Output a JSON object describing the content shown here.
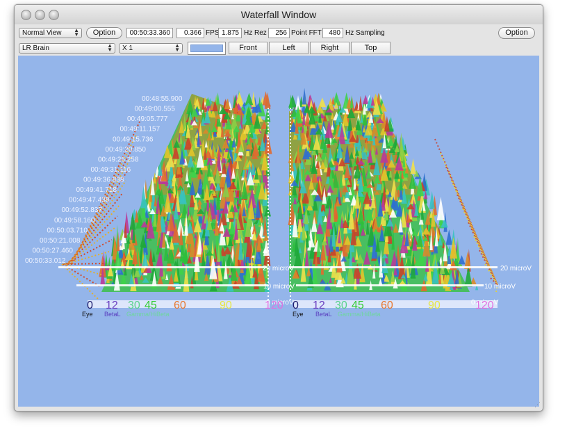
{
  "window": {
    "title": "Waterfall Window"
  },
  "toolbar": {
    "view_mode": "Normal View",
    "option_label": "Option",
    "option_right_label": "Option",
    "time_value": "00:50:33.360",
    "fps_value": "0.366",
    "fps_label": "FPS",
    "hz_rez_value": "1.875",
    "hz_rez_label": "Hz Rez",
    "fft_value": "256",
    "fft_label": "Point FFT",
    "sampling_value": "480",
    "sampling_label": "Hz Sampling",
    "channel": "LR Brain",
    "scale": "X 1",
    "bg_color": "#94b5ea",
    "front_label": "Front",
    "left_label": "Left",
    "right_label": "Right",
    "top_label": "Top"
  },
  "plot": {
    "background": "#94b5ea",
    "timestamps": [
      "00:48:55.900",
      "00:49:00.555",
      "00:49:05.777",
      "00:49:11.157",
      "00:49:15.736",
      "00:49:20.850",
      "00:49:26.258",
      "00:49:31.116",
      "00:49:36.838",
      "00:49:41.718",
      "00:49:47.438",
      "00:49:52.837",
      "00:49:58.160",
      "00:50:03.710",
      "00:50:21.008",
      "00:50:27.460",
      "00:50:33.012"
    ],
    "amplitude_labels": [
      "20 microV",
      "10 microV",
      "0 microV"
    ],
    "freq_ticks": [
      {
        "text": "0",
        "color": "#1c1c6e"
      },
      {
        "text": "12",
        "color": "#6a3fc0"
      },
      {
        "text": "30",
        "color": "#59d38c"
      },
      {
        "text": "45",
        "color": "#33cc33"
      },
      {
        "text": "60",
        "color": "#e87830"
      },
      {
        "text": "90",
        "color": "#e6e646"
      },
      {
        "text": "120",
        "color": "#e070e0"
      }
    ],
    "band_labels": [
      {
        "text": "Eye",
        "color": "#111111"
      },
      {
        "text": "BetaL",
        "color": "#5a3fc0"
      },
      {
        "text": "Gamma/HiBeta",
        "color": "#6fd6a0"
      }
    ]
  }
}
